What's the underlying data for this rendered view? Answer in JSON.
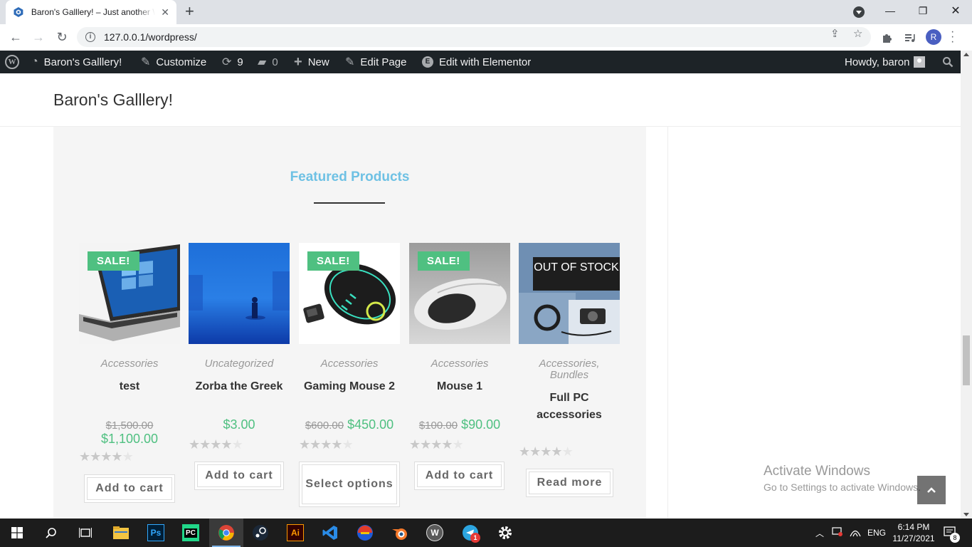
{
  "browser": {
    "tab_title": "Baron's Galllery! – Just another WordPress site",
    "new_tab": "+",
    "url": "127.0.0.1/wordpress/",
    "profile_initial": "R"
  },
  "admin_bar": {
    "site_name": "Baron's Galllery!",
    "customize": "Customize",
    "updates_count": "9",
    "comments_count": "0",
    "new": "New",
    "edit_page": "Edit Page",
    "edit_elementor": "Edit with Elementor",
    "howdy": "Howdy, baron"
  },
  "site": {
    "title": "Baron's Galllery!",
    "section_title": "Featured Products"
  },
  "products": [
    {
      "category": "Accessories",
      "name": "test",
      "old_price": "$1,500.00",
      "price": "$1,100.00",
      "badge": "SALE!",
      "rating_stars": 4,
      "button": "Add to cart"
    },
    {
      "category": "Uncategorized",
      "name": "Zorba the Greek",
      "old_price": "",
      "price": "$3.00",
      "badge": "",
      "rating_stars": 4,
      "button": "Add to cart"
    },
    {
      "category": "Accessories",
      "name": "Gaming Mouse 2",
      "old_price": "$600.00",
      "price": "$450.00",
      "badge": "SALE!",
      "rating_stars": 4,
      "button": "Select options"
    },
    {
      "category": "Accessories",
      "name": "Mouse 1",
      "old_price": "$100.00",
      "price": "$90.00",
      "badge": "SALE!",
      "rating_stars": 4,
      "button": "Add to cart"
    },
    {
      "category": "Accessories, Bundles",
      "name": "Full PC accessories",
      "old_price": "",
      "price": "",
      "badge": "OUT OF STOCK",
      "rating_stars": 4,
      "button": "Read more"
    }
  ],
  "watermark": {
    "line1": "Activate Windows",
    "line2": "Go to Settings to activate Windows."
  },
  "taskbar": {
    "language": "ENG",
    "time": "6:14 PM",
    "date": "11/27/2021",
    "notification_count": "8",
    "telegram_badge": "1"
  }
}
